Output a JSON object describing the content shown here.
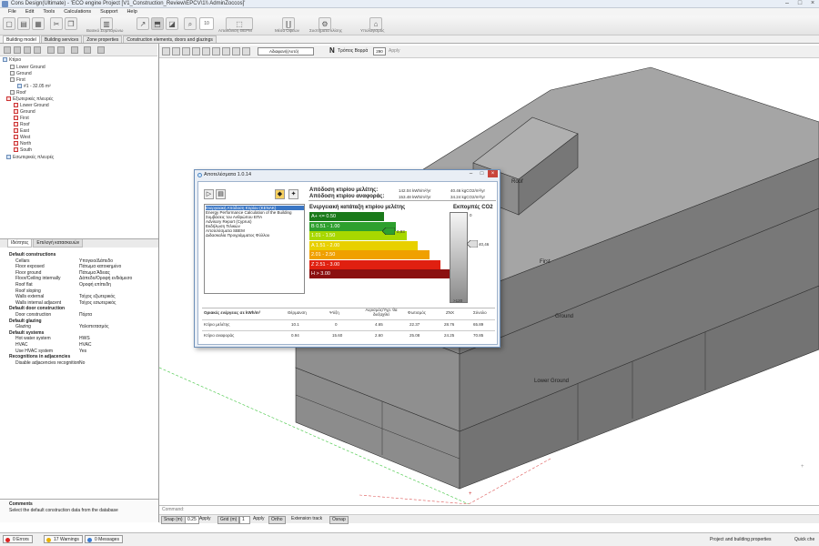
{
  "window": {
    "title": "Cons Design(Ultimate) - 'ECO engine Project [V1_Construction_Review\\EPCV\\1\\\\ AdminZoccos]'"
  },
  "menu": [
    "File",
    "Edit",
    "Tools",
    "Calculations",
    "Support",
    "Help"
  ],
  "toolbar": {
    "zoom_value": "10",
    "btn1_label": "Βασικό Συμπαγώνω",
    "btn2_label": "Απεικόνιση ΘΕΡΜ",
    "btn3_label": "Μέσα Όψεων",
    "btn4_label": "Συστήματα κλίσης",
    "btn5_label": "Υπολογισμός"
  },
  "tabs": [
    "Building model",
    "Building services",
    "Zone properties",
    "Construction elements, doors and glazings"
  ],
  "tree": [
    "Κτίριο",
    "Lower Ground",
    "Ground",
    "First",
    "#1 - 32.05 m²",
    "Roof",
    "Εξωτερικές πλευρές",
    "Lower Ground",
    "Ground",
    "First",
    "Roof",
    "East",
    "West",
    "North",
    "South",
    "Εσωτερικές πλευρές"
  ],
  "lower_tabs": [
    "Ιδιότητες",
    "Επιλογή κατασκευών"
  ],
  "properties": [
    {
      "section": true,
      "k": "Default constructions",
      "v": ""
    },
    {
      "k": "Cellars",
      "v": "Υπογειο/Δάπεδο"
    },
    {
      "k": "Floor exposed",
      "v": "Πάτωμα κατοικημένο"
    },
    {
      "k": "Floor ground",
      "v": "Πάτωμα Άδειας"
    },
    {
      "k": "Floor/Ceiling internally",
      "v": "Δάπεδο/Οροφή ενδιάμεσο"
    },
    {
      "k": "Roof flat",
      "v": "Οροφή επίπεδη"
    },
    {
      "k": "Roof sloping",
      "v": ""
    },
    {
      "k": "Walls external",
      "v": "Τοίχος εξωτερικός"
    },
    {
      "k": "Walls internal adjacent",
      "v": "Τοίχος εσωτερικός"
    },
    {
      "section": true,
      "k": "Default door construction",
      "v": ""
    },
    {
      "k": "Door construction",
      "v": "Πόρτα"
    },
    {
      "section": true,
      "k": "Default glazing",
      "v": ""
    },
    {
      "k": "Glazing",
      "v": "Υαλοπετασμός"
    },
    {
      "section": true,
      "k": "Default systems",
      "v": ""
    },
    {
      "k": "Hot water system",
      "v": "HWS"
    },
    {
      "k": "HVAC",
      "v": "HVAC"
    },
    {
      "k": "Use HVAC system",
      "v": "Yes"
    },
    {
      "section": true,
      "k": "Recognitions in adjacencies",
      "v": ""
    },
    {
      "k": "Disable adjacencies recognition",
      "v": "No"
    }
  ],
  "comments": {
    "title": "Comments",
    "text": "Select the default construction data from the database"
  },
  "view_toolbar": {
    "dropdown": "Αδιαφανή(Αυτό)",
    "label": "Τρόπος Βορρά",
    "value": "290",
    "apply": "Apply"
  },
  "model_labels": [
    "Roof",
    "First",
    "Ground",
    "Lower Ground"
  ],
  "command_label": "Command:",
  "gridbar": {
    "snap_label": "Snap (m)",
    "snap_value": "0.25",
    "apply1": "Apply",
    "grid_label": "Grid (m)",
    "grid_value": "1",
    "apply2": "Apply",
    "ortho": "Ortho",
    "ext_track": "Extension track",
    "osnap": "Osnap"
  },
  "status": {
    "errors": "0 Errors",
    "warnings": "17 Warnings",
    "messages": "0 Messages",
    "project_props": "Project and building properties",
    "quick": "Quick che"
  },
  "dialog": {
    "title": "Αποτελέσματα 1.0.14",
    "list": [
      "Ενεργειακή Απόδοση Κτιρίου (ΚΕΝΑΚ)",
      "Energy Performance Calculation of the Building",
      "Συμβάσεις του Ανθρώπου ΕΠΑ",
      "Advisory Report (Cyprus)",
      "Εκδήλωση Τελικών",
      "Αποτελέσματα SBEM",
      "Διδασκαλία Προγράμματος Φύλλου"
    ],
    "perf1_label": "Απόδοση κτιρίου μελέτης:",
    "perf1_energy": "142.04 kWh/m²/yr",
    "perf1_co2": "40.46 kgCO2/m²/yr",
    "perf2_label": "Απόδοση κτιρίου αναφοράς:",
    "perf2_energy": "153.48 kWh/m²/yr",
    "perf2_co2": "34.24 kgCO2/m²/yr",
    "class_title": "Ενεργειακή κατάταξη κτιρίου μελέτης",
    "co2_title": "Εκπομπές CO2",
    "bands": [
      {
        "label": "A+ <= 0.50",
        "color": "#1a7a1a",
        "w": 0.4
      },
      {
        "label": "B 0.51 - 1.00",
        "color": "#2ea02e",
        "w": 0.46
      },
      {
        "label": "1.01 - 1.50",
        "color": "#a8d800",
        "w": 0.52
      },
      {
        "label": "A 1.51 - 2.00",
        "color": "#e8d000",
        "w": 0.58
      },
      {
        "label": "2.01 - 2.50",
        "color": "#f0a000",
        "w": 0.64
      },
      {
        "label": "Z 2.51 - 3.00",
        "color": "#e02010",
        "w": 0.7
      },
      {
        "label": "H > 3.00",
        "color": "#8b1010",
        "w": 0.76
      }
    ],
    "rating_value": "0,93",
    "co2_value": "40,46",
    "gauge_top": "0",
    "gauge_bottom": ">120",
    "table_head": [
      "Οριακές ενέργειες σε kWh/m²",
      "Θέρμανση",
      "Ψύξη",
      "Αερισμός/Υγρ. θα διεξαχθεί",
      "Φωτισμός",
      "ΖΝΧ",
      "Σύνολο"
    ],
    "table_rows": [
      [
        "Κτίριο μελέτης",
        "10.1",
        "0",
        "4.65",
        "22.37",
        "28.76",
        "65.89"
      ],
      [
        "Κτίριο αναφοράς",
        "0.94",
        "15.60",
        "2.60",
        "25.08",
        "24.25",
        "70.85"
      ]
    ]
  }
}
